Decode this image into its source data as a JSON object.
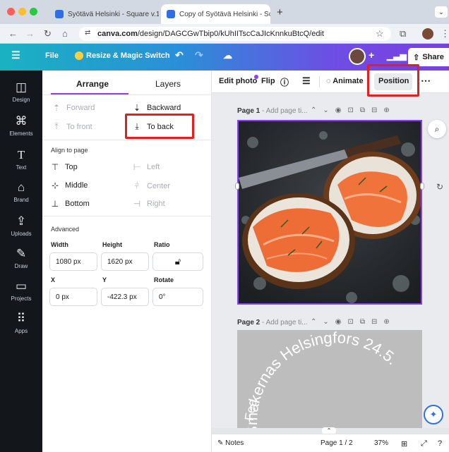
{
  "browser": {
    "tabs": [
      {
        "title": "Syötävä Helsinki - Square v.1"
      },
      {
        "title": "Copy of Syötävä Helsinki - Sc"
      }
    ],
    "url_host": "canva.com",
    "url_path": "/design/DAGCGwTbip0/kUhIITscCaJIcKnnkuBtcQ/edit"
  },
  "topbar": {
    "file": "File",
    "resize": "Resize & Magic Switch",
    "share": "Share"
  },
  "rail": [
    {
      "label": "Design",
      "icon": "◫"
    },
    {
      "label": "Elements",
      "icon": "⌘"
    },
    {
      "label": "Text",
      "icon": "T"
    },
    {
      "label": "Brand",
      "icon": "⌂"
    },
    {
      "label": "Uploads",
      "icon": "⇪"
    },
    {
      "label": "Draw",
      "icon": "✎"
    },
    {
      "label": "Projects",
      "icon": "▭"
    },
    {
      "label": "Apps",
      "icon": "⠿"
    }
  ],
  "panel": {
    "tab_arrange": "Arrange",
    "tab_layers": "Layers",
    "forward": "Forward",
    "backward": "Backward",
    "to_front": "To front",
    "to_back": "To back",
    "align_heading": "Align to page",
    "top": "Top",
    "left": "Left",
    "middle": "Middle",
    "center": "Center",
    "bottom": "Bottom",
    "right": "Right",
    "advanced_heading": "Advanced",
    "width_label": "Width",
    "height_label": "Height",
    "ratio_label": "Ratio",
    "width_value": "1080 px",
    "height_value": "1620 px",
    "x_label": "X",
    "y_label": "Y",
    "rotate_label": "Rotate",
    "x_value": "0 px",
    "y_value": "-422.3 px",
    "rotate_value": "0°"
  },
  "context": {
    "edit_photo": "Edit photo",
    "flip": "Flip",
    "animate": "Animate",
    "position": "Position"
  },
  "pages": {
    "page1_prefix": "Page 1",
    "page1_title": " - Add page ti...",
    "page2_prefix": "Page 2",
    "page2_title": " - Add page ti...",
    "arc_text": "Smakernas Helsingfors 24.5.",
    "arc_lower": "Fea"
  },
  "bottom": {
    "notes": "Notes",
    "page_counter": "Page 1 / 2",
    "zoom": "37%"
  },
  "colors": {
    "highlight": "#e41f1f",
    "accent": "#8b3dff"
  }
}
